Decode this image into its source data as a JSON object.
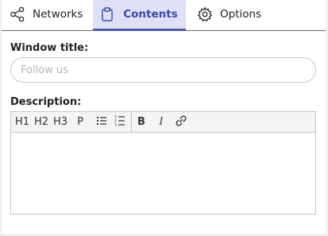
{
  "tabs": {
    "networks": {
      "label": "Networks",
      "icon": "share-icon"
    },
    "contents": {
      "label": "Contents",
      "icon": "clipboard-icon",
      "active": true
    },
    "options": {
      "label": "Options",
      "icon": "gear-icon"
    }
  },
  "form": {
    "window_title": {
      "label": "Window title:",
      "placeholder": "Follow us",
      "value": ""
    },
    "description": {
      "label": "Description:",
      "value": ""
    }
  },
  "toolbar": {
    "h1": "H1",
    "h2": "H2",
    "h3": "H3",
    "p": "P",
    "bullet_list_icon": "bullet-list-icon",
    "numbered_list_icon": "numbered-list-icon",
    "bold": "B",
    "italic": "I",
    "link_icon": "link-icon"
  },
  "colors": {
    "accent": "#4d59b0",
    "active_tab_bg": "#dfe0f6",
    "active_tab_text": "#3b4aa6"
  }
}
